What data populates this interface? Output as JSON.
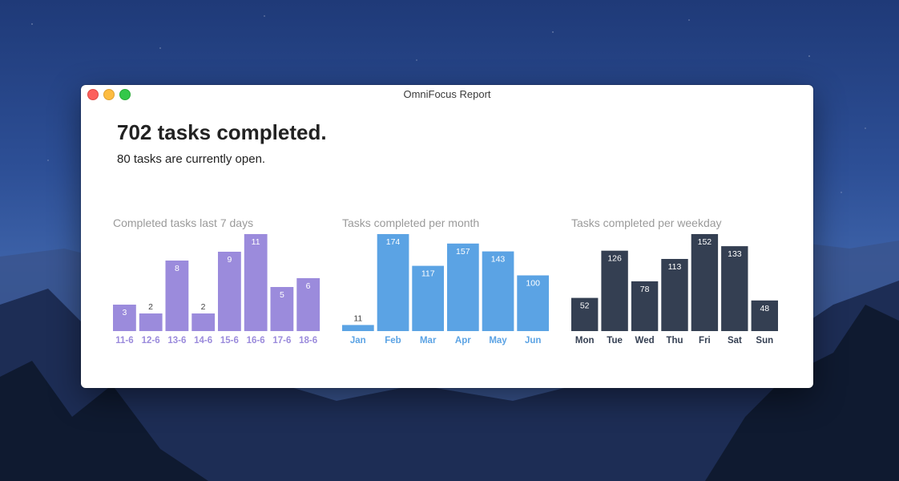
{
  "window": {
    "title": "OmniFocus Report"
  },
  "summary": {
    "headline": "702 tasks completed.",
    "subline": "80 tasks are currently open."
  },
  "colors": {
    "days": "#9b8bdc",
    "months": "#5ba3e4",
    "weekdays": "#343f52"
  },
  "chart_data": [
    {
      "type": "bar",
      "title": "Completed tasks last 7 days",
      "color": "#9b8bdc",
      "categories": [
        "11-6",
        "12-6",
        "13-6",
        "14-6",
        "15-6",
        "16-6",
        "17-6",
        "18-6"
      ],
      "values": [
        3,
        2,
        8,
        2,
        9,
        11,
        5,
        6
      ],
      "ylim": [
        0,
        11
      ]
    },
    {
      "type": "bar",
      "title": "Tasks completed per month",
      "color": "#5ba3e4",
      "categories": [
        "Jan",
        "Feb",
        "Mar",
        "Apr",
        "May",
        "Jun"
      ],
      "values": [
        11,
        174,
        117,
        157,
        143,
        100
      ],
      "ylim": [
        0,
        174
      ]
    },
    {
      "type": "bar",
      "title": "Tasks completed per weekday",
      "color": "#343f52",
      "categories": [
        "Mon",
        "Tue",
        "Wed",
        "Thu",
        "Fri",
        "Sat",
        "Sun"
      ],
      "values": [
        52,
        126,
        78,
        113,
        152,
        133,
        48
      ],
      "ylim": [
        0,
        152
      ]
    }
  ]
}
